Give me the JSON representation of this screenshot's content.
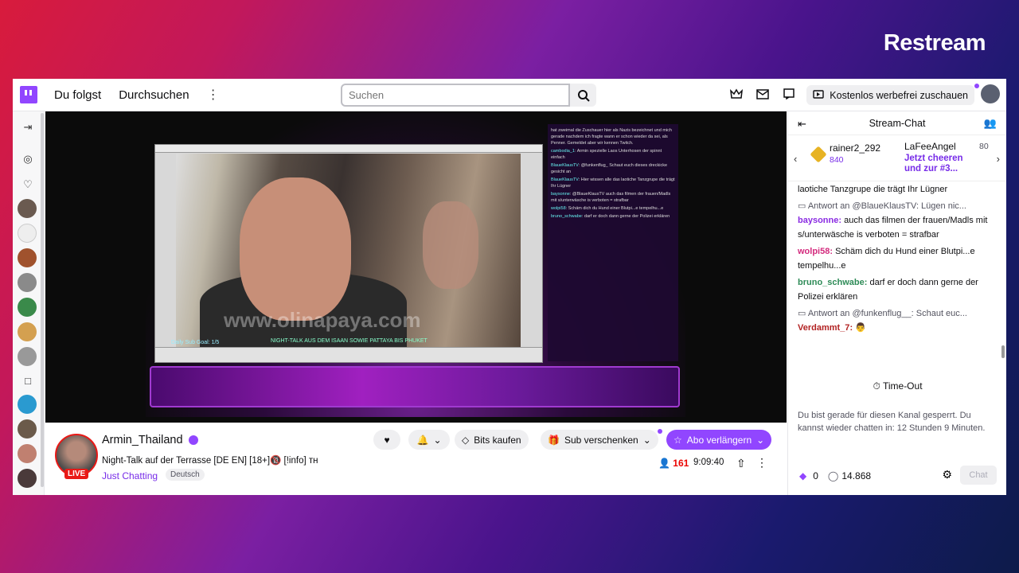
{
  "brand": "Restream",
  "nav": {
    "following": "Du folgst",
    "browse": "Durchsuchen",
    "search_placeholder": "Suchen",
    "adfree_label": "Kostenlos werbefrei zuschauen"
  },
  "stream": {
    "overlay_watermark": "www.olinapaya.com",
    "overlay_subgoal": "Daily Sub Goal: 1/5",
    "overlay_night": "NIGHT-TALK AUS DEM ISAAN SOWIE PATTAYA BIS PHUKET",
    "overlay_chat": [
      {
        "user": "",
        "text": "hat zweimal die Zuschauer hier als Nazis bezeichnet und mich gerade nachdem ich fragte wann er schon wieder da sei, als Penner. Gemeldet aber wir kennen Twitch."
      },
      {
        "user": "cambodia_1",
        "text": ": Armin spezielle Laos Unterhosen der spinnt einfach"
      },
      {
        "user": "BlaueKlausTV",
        "text": ": @funkenflug_ Schaut euch dieses dreckicke gesicht an"
      },
      {
        "user": "BlaueKlausTV",
        "text": ": Hier wissen alle das laotiche Tanzgrupe die trägt Ihr Lügner"
      },
      {
        "user": "baysonne",
        "text": ": @BlaueKlausTV auch das filmen der frauen/Madls mit s/unterwäsche is verboten = strafbar"
      },
      {
        "user": "wolpi58",
        "text": ": Schäm dich du Hund einer Blutpi...e tempelhu...e"
      },
      {
        "user": "bruno_schwabe",
        "text": ": darf er doch dann gerne der Polizei erklären"
      }
    ]
  },
  "channel": {
    "name": "Armin_Thailand",
    "live_badge": "LIVE",
    "title": "Night-Talk auf der Terrasse [DE EN] [18+]🔞 [!info] ᴛʜ",
    "category": "Just Chatting",
    "tag": "Deutsch",
    "bits_label": "Bits kaufen",
    "gift_label": "Sub verschenken",
    "renew_label": "Abo verlängern",
    "viewers": "161",
    "uptime": "9:09:40"
  },
  "chat": {
    "header": "Stream-Chat",
    "leaderboard": [
      {
        "name": "rainer2_292",
        "amount": "840"
      },
      {
        "name": "LaFeeAngel",
        "amount": "80"
      }
    ],
    "cheer_cta": "Jetzt cheeren und zur #3...",
    "messages": [
      {
        "type": "msg",
        "user": "",
        "text": "laotiche Tanzgrupe die trägt Ihr Lügner"
      },
      {
        "type": "reply",
        "text": "Antwort an @BlaueKlausTV: Lügen nic..."
      },
      {
        "type": "msg",
        "user": "baysonne",
        "cls": "u-bays",
        "text": " auch das filmen der frauen/Madls mit s/unterwäsche is verboten = strafbar"
      },
      {
        "type": "msg",
        "user": "wolpi58",
        "cls": "u-wol",
        "text": " Schäm dich du Hund einer Blutpi...e tempelhu...e"
      },
      {
        "type": "msg",
        "user": "bruno_schwabe",
        "cls": "u-bru",
        "text": " darf er doch dann gerne der Polizei erklären"
      },
      {
        "type": "reply",
        "text": "Antwort an @funkenflug__: Schaut euc..."
      },
      {
        "type": "msg",
        "user": "Verdammt_7",
        "cls": "u-ver",
        "text": " 👨"
      }
    ],
    "timeout_label": "Time-Out",
    "banned_text": "Du bist gerade für diesen Kanal gesperrt. Du kannst wieder chatten in: 12 Stunden 9 Minuten.",
    "bits_count": "0",
    "points": "14.868",
    "chat_button": "Chat"
  }
}
